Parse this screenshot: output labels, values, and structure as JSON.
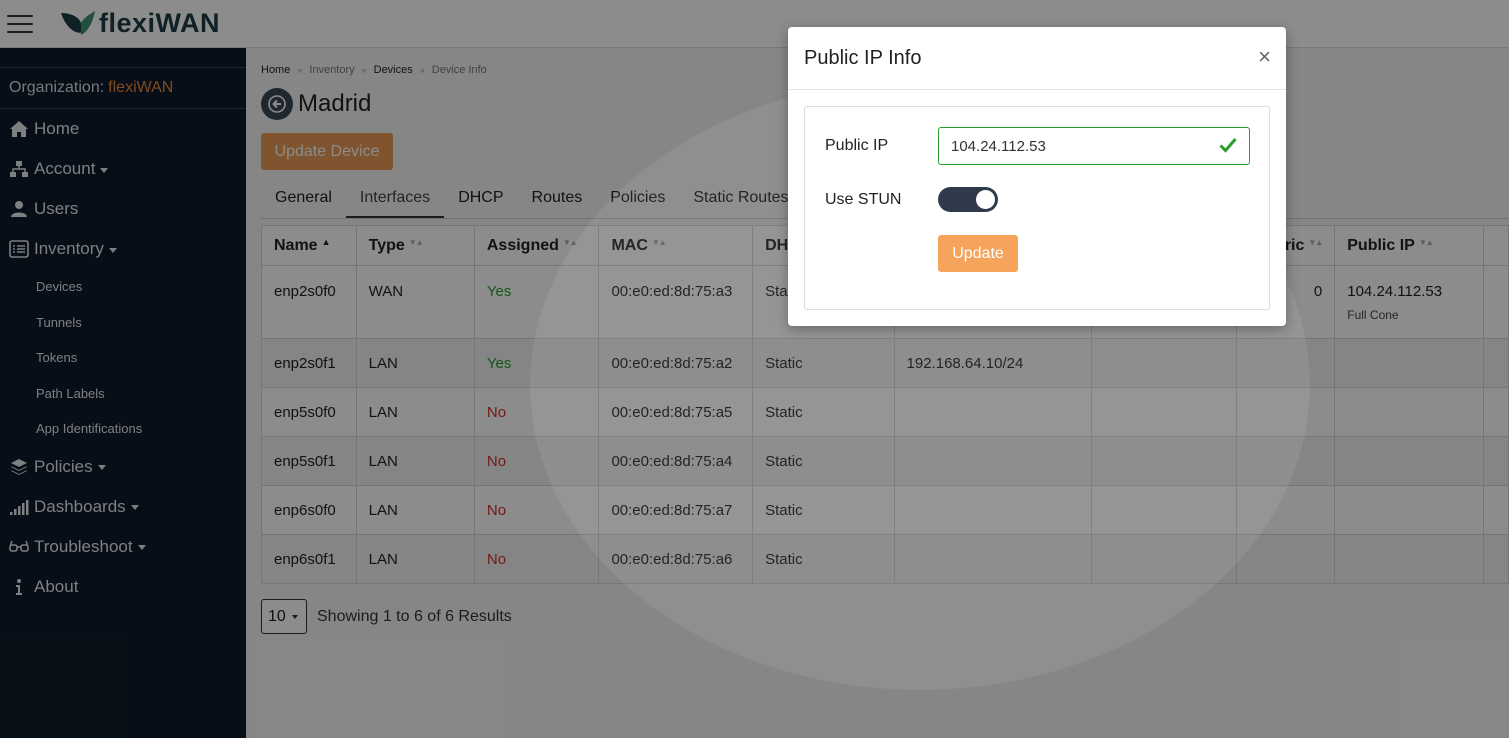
{
  "header": {
    "logo_text_a": "flexi",
    "logo_text_b": "WAN"
  },
  "sidebar": {
    "org_label": "Organization:",
    "org_name": "flexiWAN",
    "items": [
      {
        "label": "Home",
        "icon": "home-icon"
      },
      {
        "label": "Account",
        "icon": "sitemap-icon"
      },
      {
        "label": "Users",
        "icon": "user-icon"
      },
      {
        "label": "Inventory",
        "icon": "list-icon"
      },
      {
        "label": "Policies",
        "icon": "layers-icon"
      },
      {
        "label": "Dashboards",
        "icon": "signal-icon"
      },
      {
        "label": "Troubleshoot",
        "icon": "glasses-icon"
      },
      {
        "label": "About",
        "icon": "info-icon"
      }
    ],
    "inventory_sub": [
      "Devices",
      "Tunnels",
      "Tokens",
      "Path Labels",
      "App Identifications"
    ]
  },
  "breadcrumb": [
    "Home",
    "Inventory",
    "Devices",
    "Device Info"
  ],
  "page": {
    "title": "Madrid",
    "update_button": "Update Device"
  },
  "tabs": [
    "General",
    "Interfaces",
    "DHCP",
    "Routes",
    "Policies",
    "Static Routes"
  ],
  "table": {
    "headers": [
      "Name",
      "Type",
      "Assigned",
      "MAC",
      "DH",
      "",
      "",
      "tric",
      "Public IP",
      ""
    ],
    "rows": [
      {
        "name": "enp2s0f0",
        "type": "WAN",
        "assigned": "Yes",
        "mac": "00:e0:ed:8d:75:a3",
        "dhcp": "Stat",
        "ip": "",
        "gw": "",
        "metric": "0",
        "public_ip": "104.24.112.53",
        "nat": "Full Cone"
      },
      {
        "name": "enp2s0f1",
        "type": "LAN",
        "assigned": "Yes",
        "mac": "00:e0:ed:8d:75:a2",
        "dhcp": "Static",
        "ip": "192.168.64.10/24",
        "gw": "",
        "metric": "",
        "public_ip": "",
        "nat": ""
      },
      {
        "name": "enp5s0f0",
        "type": "LAN",
        "assigned": "No",
        "mac": "00:e0:ed:8d:75:a5",
        "dhcp": "Static",
        "ip": "",
        "gw": "",
        "metric": "",
        "public_ip": "",
        "nat": ""
      },
      {
        "name": "enp5s0f1",
        "type": "LAN",
        "assigned": "No",
        "mac": "00:e0:ed:8d:75:a4",
        "dhcp": "Static",
        "ip": "",
        "gw": "",
        "metric": "",
        "public_ip": "",
        "nat": ""
      },
      {
        "name": "enp6s0f0",
        "type": "LAN",
        "assigned": "No",
        "mac": "00:e0:ed:8d:75:a7",
        "dhcp": "Static",
        "ip": "",
        "gw": "",
        "metric": "",
        "public_ip": "",
        "nat": ""
      },
      {
        "name": "enp6s0f1",
        "type": "LAN",
        "assigned": "No",
        "mac": "00:e0:ed:8d:75:a6",
        "dhcp": "Static",
        "ip": "",
        "gw": "",
        "metric": "",
        "public_ip": "",
        "nat": ""
      }
    ]
  },
  "pager": {
    "per_page": "10",
    "showing": "Showing 1 to 6 of 6 Results"
  },
  "modal": {
    "title": "Public IP Info",
    "close": "×",
    "public_ip_label": "Public IP",
    "public_ip_value": "104.24.112.53",
    "stun_label": "Use STUN",
    "stun_enabled": true,
    "update_label": "Update"
  },
  "colors": {
    "accent": "#e58b3a",
    "sidebar_bg": "#0d1b2a",
    "success": "#2a9d2a",
    "danger": "#d62d2d"
  }
}
